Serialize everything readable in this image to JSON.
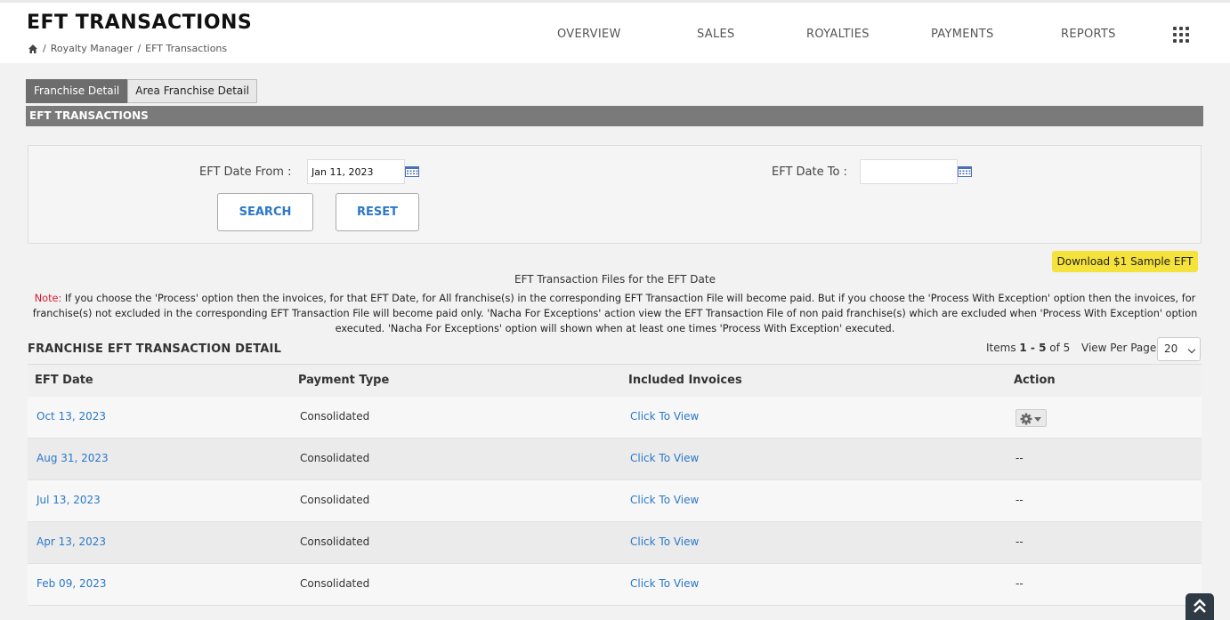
{
  "header": {
    "title": "EFT TRANSACTIONS",
    "breadcrumb": [
      "Royalty Manager",
      "EFT Transactions"
    ],
    "nav": [
      "OVERVIEW",
      "SALES",
      "ROYALTIES",
      "PAYMENTS",
      "REPORTS"
    ]
  },
  "tabs": [
    "Franchise Detail",
    "Area Franchise Detail"
  ],
  "section_title": "EFT TRANSACTIONS",
  "search": {
    "from_label": "EFT Date From :",
    "from_value": "Jan 11, 2023",
    "to_label": "EFT Date To :",
    "to_value": "",
    "search_label": "SEARCH",
    "reset_label": "RESET"
  },
  "download_label": "Download $1 Sample EFT",
  "files_title": "EFT Transaction Files for the EFT Date",
  "note": {
    "label": "Note:",
    "text": " If you choose the 'Process' option then the invoices, for that EFT Date, for All franchise(s) in the corresponding EFT Transaction File will become paid. But if you choose the 'Process With Exception' option then the invoices, for franchise(s) not excluded in the corresponding EFT Transaction File will become paid only. 'Nacha For Exceptions' action view the EFT Transaction File of non paid franchise(s) which are excluded when 'Process With Exception' option executed. 'Nacha For Exceptions' option will shown when at least one times 'Process With Exception' executed."
  },
  "detail_title": "FRANCHISE EFT TRANSACTION DETAIL",
  "pagination": {
    "items_prefix": "Items ",
    "range": "1 - 5",
    "of_text": " of 5",
    "view_per_page_label": "View Per Page",
    "view_per_page_value": "20"
  },
  "table": {
    "columns": [
      "EFT Date",
      "Payment Type",
      "Included Invoices",
      "Action"
    ],
    "rows": [
      {
        "date": "Oct 13, 2023",
        "type": "Consolidated",
        "invoices": "Click To View",
        "action": ""
      },
      {
        "date": "Aug 31, 2023",
        "type": "Consolidated",
        "invoices": "Click To View",
        "action": "--"
      },
      {
        "date": "Jul 13, 2023",
        "type": "Consolidated",
        "invoices": "Click To View",
        "action": "--"
      },
      {
        "date": "Apr 13, 2023",
        "type": "Consolidated",
        "invoices": "Click To View",
        "action": "--"
      },
      {
        "date": "Feb 09, 2023",
        "type": "Consolidated",
        "invoices": "Click To View",
        "action": "--"
      }
    ]
  },
  "icons": {
    "home": "home-icon",
    "apps": "apps-grid-icon",
    "calendar": "calendar-icon",
    "gear": "gear-icon",
    "scroll_top": "double-chevron-up-icon"
  },
  "colors": {
    "link": "#2a78c8",
    "note_label": "#e0162b",
    "download_bg": "#f5e23a",
    "section_bar": "#7a7a7a"
  }
}
